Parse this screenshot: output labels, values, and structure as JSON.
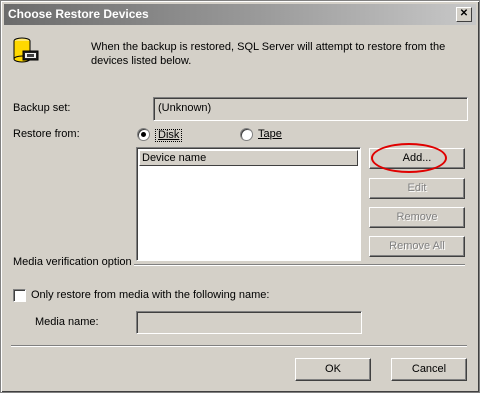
{
  "window": {
    "title": "Choose Restore Devices",
    "close_glyph": "✕"
  },
  "info": {
    "icon": "database-tape-icon",
    "text_line1": "When the backup is restored, SQL Server will attempt to restore from the",
    "text_line2": "devices listed below."
  },
  "backup_set": {
    "label": "Backup set:",
    "value": "(Unknown)"
  },
  "restore_from": {
    "label": "Restore from:",
    "options": [
      {
        "label": "Disk",
        "selected": true
      },
      {
        "label": "Tape",
        "selected": false
      }
    ]
  },
  "device_list": {
    "header": "Device name",
    "rows": []
  },
  "buttons": {
    "add": "Add...",
    "edit": "Edit",
    "remove": "Remove",
    "remove_all": "Remove All",
    "ok": "OK",
    "cancel": "Cancel"
  },
  "media_verification": {
    "label": "Media verification option",
    "checkbox_label": "Only restore from media with the following name:",
    "checked": false,
    "media_name_label": "Media name:",
    "media_name_value": ""
  },
  "colors": {
    "face": "#d4d0c8",
    "annotation": "#e00000"
  }
}
